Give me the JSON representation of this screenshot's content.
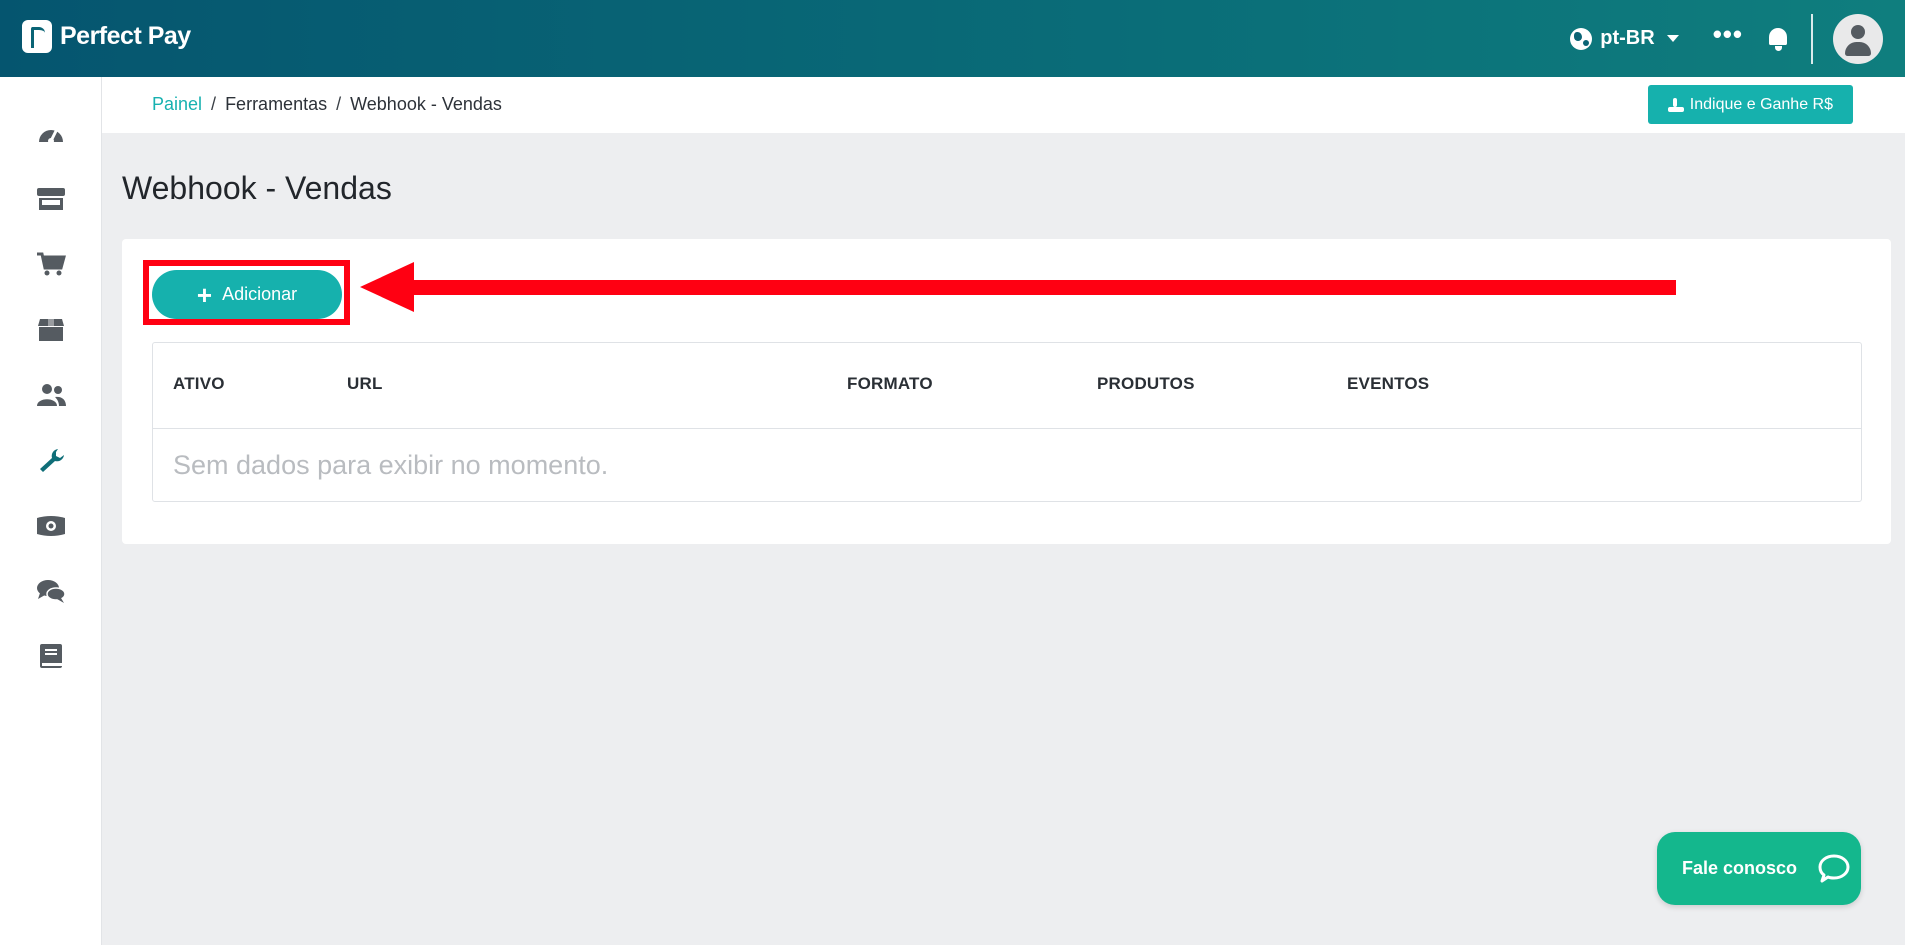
{
  "brand": {
    "name": "Perfect Pay",
    "logo_icon": "perfectpay-logo-icon"
  },
  "header": {
    "language": "pt-BR",
    "more_icon": "ellipsis-icon",
    "notification_icon": "bell-icon",
    "avatar_icon": "user-avatar-icon",
    "gradient_start": "#05556f",
    "gradient_end": "#0f7e7e"
  },
  "sidebar": {
    "items": [
      {
        "name": "dashboard",
        "icon": "speedometer-icon"
      },
      {
        "name": "store",
        "icon": "store-icon"
      },
      {
        "name": "sales",
        "icon": "shopping-cart-icon"
      },
      {
        "name": "products",
        "icon": "box-icon"
      },
      {
        "name": "users",
        "icon": "users-icon"
      },
      {
        "name": "tools",
        "icon": "wrench-icon",
        "active": true
      },
      {
        "name": "finance",
        "icon": "money-icon"
      },
      {
        "name": "support",
        "icon": "chat-bubbles-icon"
      },
      {
        "name": "docs",
        "icon": "book-icon"
      }
    ],
    "active_color": "#0f6e78",
    "icon_color": "#555b61"
  },
  "breadcrumb": {
    "items": [
      "Painel",
      "Ferramentas",
      "Webhook - Vendas"
    ],
    "separator": "/"
  },
  "refer_button": {
    "label": "Indique e Ganhe R$",
    "icon": "hand-coin-icon"
  },
  "page": {
    "title": "Webhook - Vendas"
  },
  "actions": {
    "add_label": "Adicionar",
    "add_icon": "plus-icon"
  },
  "table": {
    "columns": [
      "ATIVO",
      "URL",
      "FORMATO",
      "PRODUTOS",
      "EVENTOS"
    ],
    "rows": [],
    "empty_message": "Sem dados para exibir no momento."
  },
  "annotation": {
    "color": "#ff0012"
  },
  "chat": {
    "label": "Fale conosco",
    "icon": "chat-bubble-icon"
  },
  "colors": {
    "accent": "#16b1ad",
    "chat": "#14b78d"
  }
}
